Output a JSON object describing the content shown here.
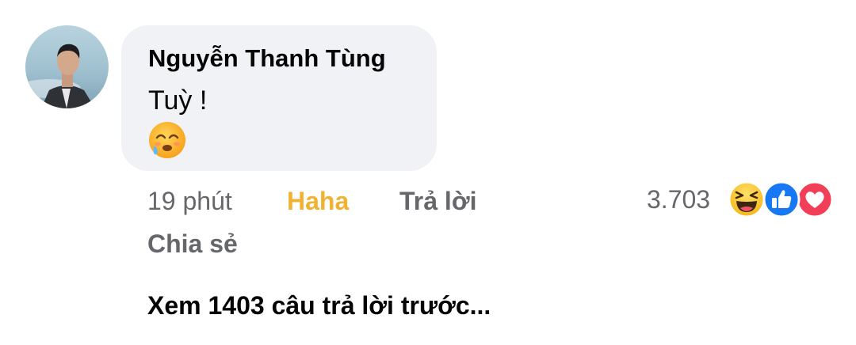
{
  "comment": {
    "author": "Nguyễn Thanh Tùng",
    "text": "Tuỳ !",
    "emoji": "face-holding-back-tears",
    "avatar": "user-avatar"
  },
  "actions": {
    "time": "19 phút",
    "reaction_label": "Haha",
    "reaction_color": "#f0b230",
    "reply_label": "Trả lời",
    "share_label": "Chia sẻ"
  },
  "reactions": {
    "count": "3.703",
    "icons": [
      "haha-icon",
      "like-icon",
      "love-icon"
    ]
  },
  "view_more": "Xem 1403 câu trả lời trước...",
  "colors": {
    "bubble": "#f0f2f5",
    "secondary_text": "#65676b",
    "primary_text": "#050505",
    "like_blue": "#1877f2",
    "love_red": "#f33e58"
  }
}
